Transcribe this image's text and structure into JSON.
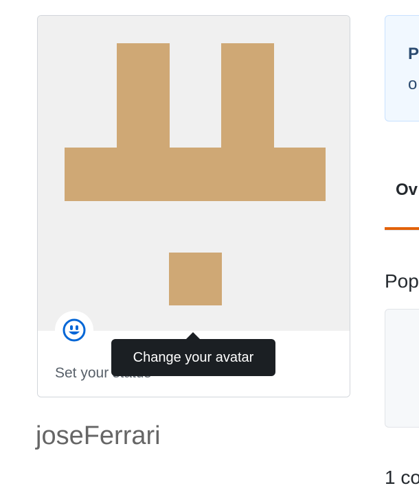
{
  "profile": {
    "username": "joseFerrari",
    "status_placeholder": "Set your status",
    "status_icon": "smiley-icon",
    "avatar_tooltip": "Change your avatar",
    "identicon_color": "#cfa875",
    "avatar_background": "#f0f0f0"
  },
  "notice": {
    "title": "P",
    "subtitle": "o"
  },
  "tabs": {
    "overview_label": "Ov",
    "active_color": "#e36209"
  },
  "main": {
    "popular_heading": "Pop",
    "contributions_text": "1 co"
  }
}
